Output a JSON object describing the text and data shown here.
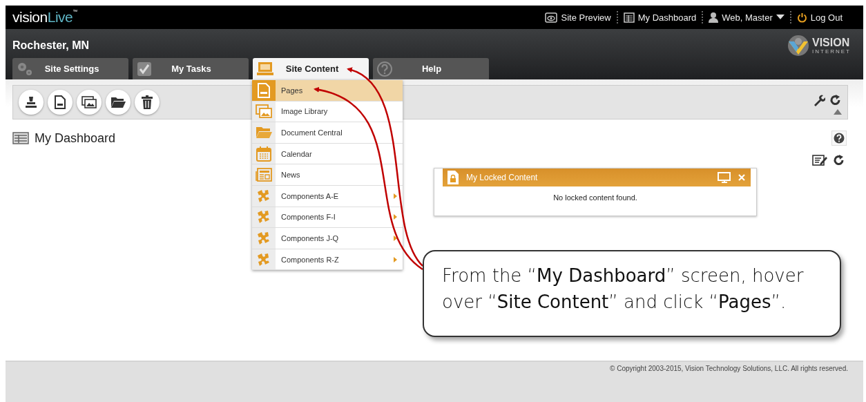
{
  "logo": {
    "part_1": "vision",
    "part_2": "Live",
    "mark": "™"
  },
  "top_links": [
    {
      "kind": "preview",
      "label": "Site Preview"
    },
    {
      "kind": "dashboard",
      "label": "My Dashboard"
    },
    {
      "kind": "user",
      "label": "Web, Master"
    },
    {
      "kind": "logout",
      "label": "Log Out"
    }
  ],
  "site_name": "Rochester, MN",
  "brand": {
    "name": "VISION",
    "tagline": "INTERNET"
  },
  "tabs": [
    {
      "kind": "gear",
      "label": "Site Settings",
      "selected": false
    },
    {
      "kind": "check",
      "label": "My Tasks",
      "selected": false
    },
    {
      "kind": "monitor",
      "label": "Site Content",
      "selected": true
    },
    {
      "kind": "help",
      "label": "Help",
      "selected": false
    }
  ],
  "menu": [
    {
      "kind": "page",
      "label": "Pages",
      "selected": true,
      "has_submenu": false
    },
    {
      "kind": "images",
      "label": "Image Library",
      "selected": false,
      "has_submenu": false
    },
    {
      "kind": "folder",
      "label": "Document Central",
      "selected": false,
      "has_submenu": false
    },
    {
      "kind": "calendar",
      "label": "Calendar",
      "selected": false,
      "has_submenu": false
    },
    {
      "kind": "news",
      "label": "News",
      "selected": false,
      "has_submenu": false
    },
    {
      "kind": "puzzle",
      "label": "Components A-E",
      "selected": false,
      "has_submenu": true
    },
    {
      "kind": "puzzle",
      "label": "Components F-I",
      "selected": false,
      "has_submenu": true
    },
    {
      "kind": "puzzle",
      "label": "Components J-Q",
      "selected": false,
      "has_submenu": true
    },
    {
      "kind": "puzzle",
      "label": "Components R-Z",
      "selected": false,
      "has_submenu": true
    }
  ],
  "page_title": "My Dashboard",
  "widget": {
    "title": "My Locked Content",
    "message": "No locked content found."
  },
  "callout": "From the “**My Dashboard**” screen, hover over “**Site Content**” and click “**Pages**”.",
  "footer": "© Copyright 2003-2015, Vision Technology Solutions, LLC. All rights reserved."
}
